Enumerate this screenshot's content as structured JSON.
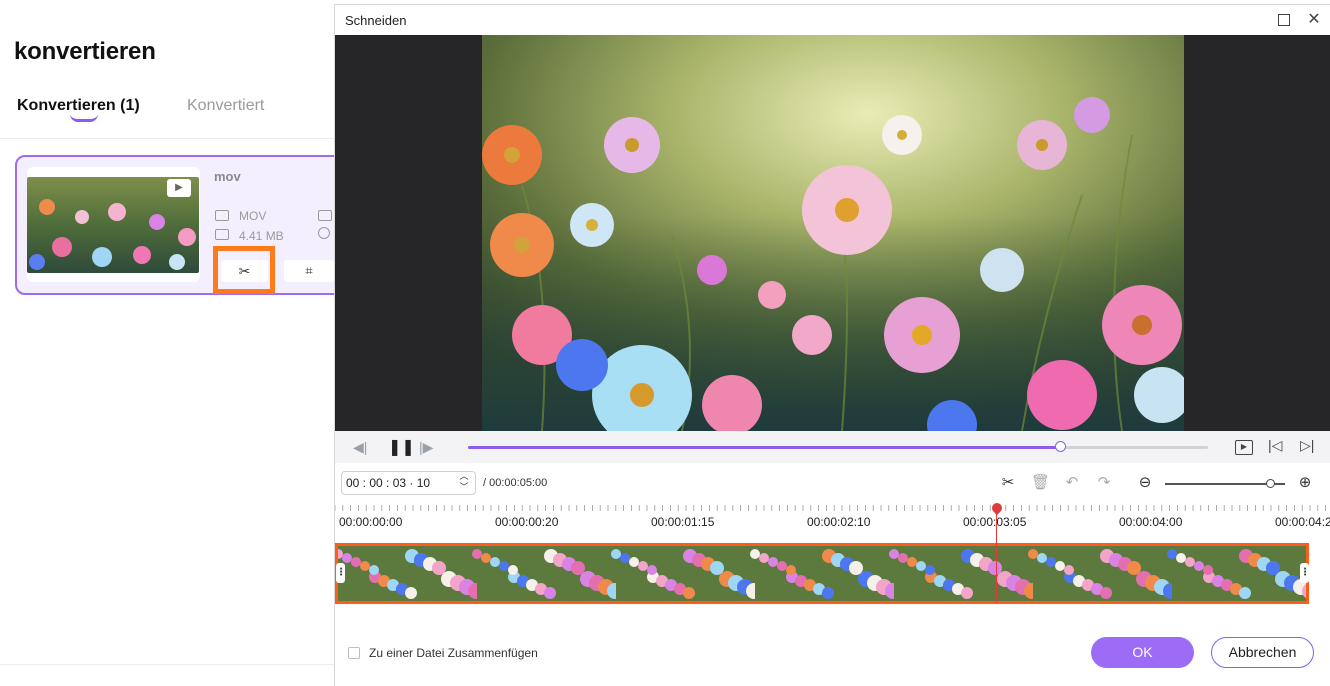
{
  "background_app": {
    "page_title": "konvertieren",
    "tabs": [
      {
        "label": "Konvertieren (1)"
      },
      {
        "label": "Konvertiert"
      }
    ],
    "file": {
      "name": "mov",
      "format": "MOV",
      "size": "4.41 MB"
    }
  },
  "dialog": {
    "title": "Schneiden",
    "playback": {
      "progress": 0.8
    },
    "timecode": {
      "current": "00 : 00 : 03 · 10",
      "duration": "/ 00:00:05:00"
    },
    "zoom_level": 0.88,
    "ruler_labels": [
      "00:00:00:00",
      "00:00:00:20",
      "00:00:01:15",
      "00:00:02:10",
      "00:00:03:05",
      "00:00:04:00",
      "00:00:04:2"
    ],
    "merge_label": "Zu einer Datei Zusammenfügen",
    "ok_label": "OK",
    "cancel_label": "Abbrechen"
  },
  "colors": {
    "accent": "#8b5cf6",
    "ok_button": "#9d6cf7",
    "highlight": "#ff7a1a",
    "selection_border": "#ff5b1a",
    "playhead": "#e23b3b"
  },
  "icons": {
    "cut": "scissors-icon",
    "crop": "crop-icon",
    "pause": "pause-icon",
    "prev": "previous-frame-icon",
    "next": "next-frame-icon"
  }
}
